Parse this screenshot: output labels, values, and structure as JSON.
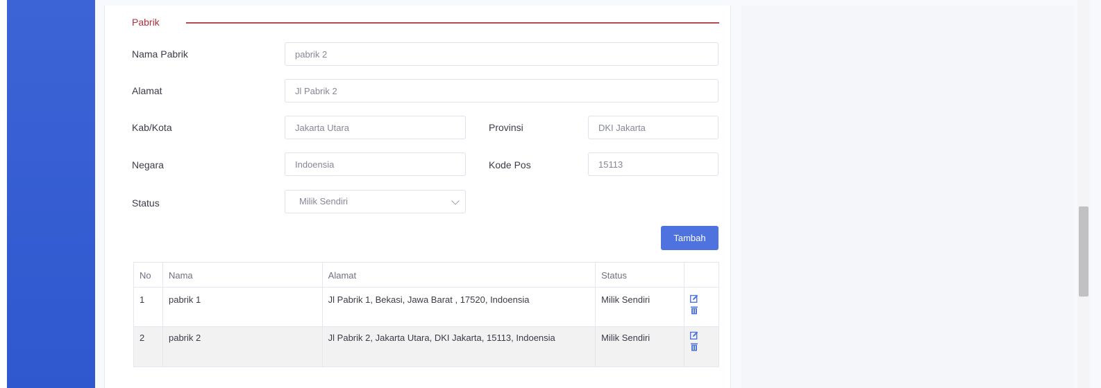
{
  "section": {
    "title": "Pabrik"
  },
  "form": {
    "nama_pabrik": {
      "label": "Nama Pabrik",
      "value": "pabrik 2"
    },
    "alamat": {
      "label": "Alamat",
      "value": "Jl Pabrik 2"
    },
    "kab_kota": {
      "label": "Kab/Kota",
      "value": "Jakarta Utara"
    },
    "provinsi": {
      "label": "Provinsi",
      "value": "DKI Jakarta"
    },
    "negara": {
      "label": "Negara",
      "value": "Indoensia"
    },
    "kode_pos": {
      "label": "Kode Pos",
      "value": "15113"
    },
    "status": {
      "label": "Status",
      "value": "Milik Sendiri"
    }
  },
  "buttons": {
    "tambah": "Tambah"
  },
  "table": {
    "headers": [
      "No",
      "Nama",
      "Alamat",
      "Status",
      ""
    ],
    "rows": [
      {
        "no": "1",
        "nama": "pabrik 1",
        "alamat": "Jl Pabrik 1, Bekasi, Jawa Barat , 17520, Indoensia",
        "status": "Milik Sendiri"
      },
      {
        "no": "2",
        "nama": "pabrik 2",
        "alamat": "Jl Pabrik 2, Jakarta Utara, DKI Jakarta, 15113, Indoensia",
        "status": "Milik Sendiri"
      }
    ]
  },
  "colors": {
    "sidebar": "#3d64d6",
    "accent": "#4e73df",
    "section_title": "#b0303c"
  },
  "icons": {
    "edit": "edit-icon",
    "delete": "trash-icon"
  }
}
